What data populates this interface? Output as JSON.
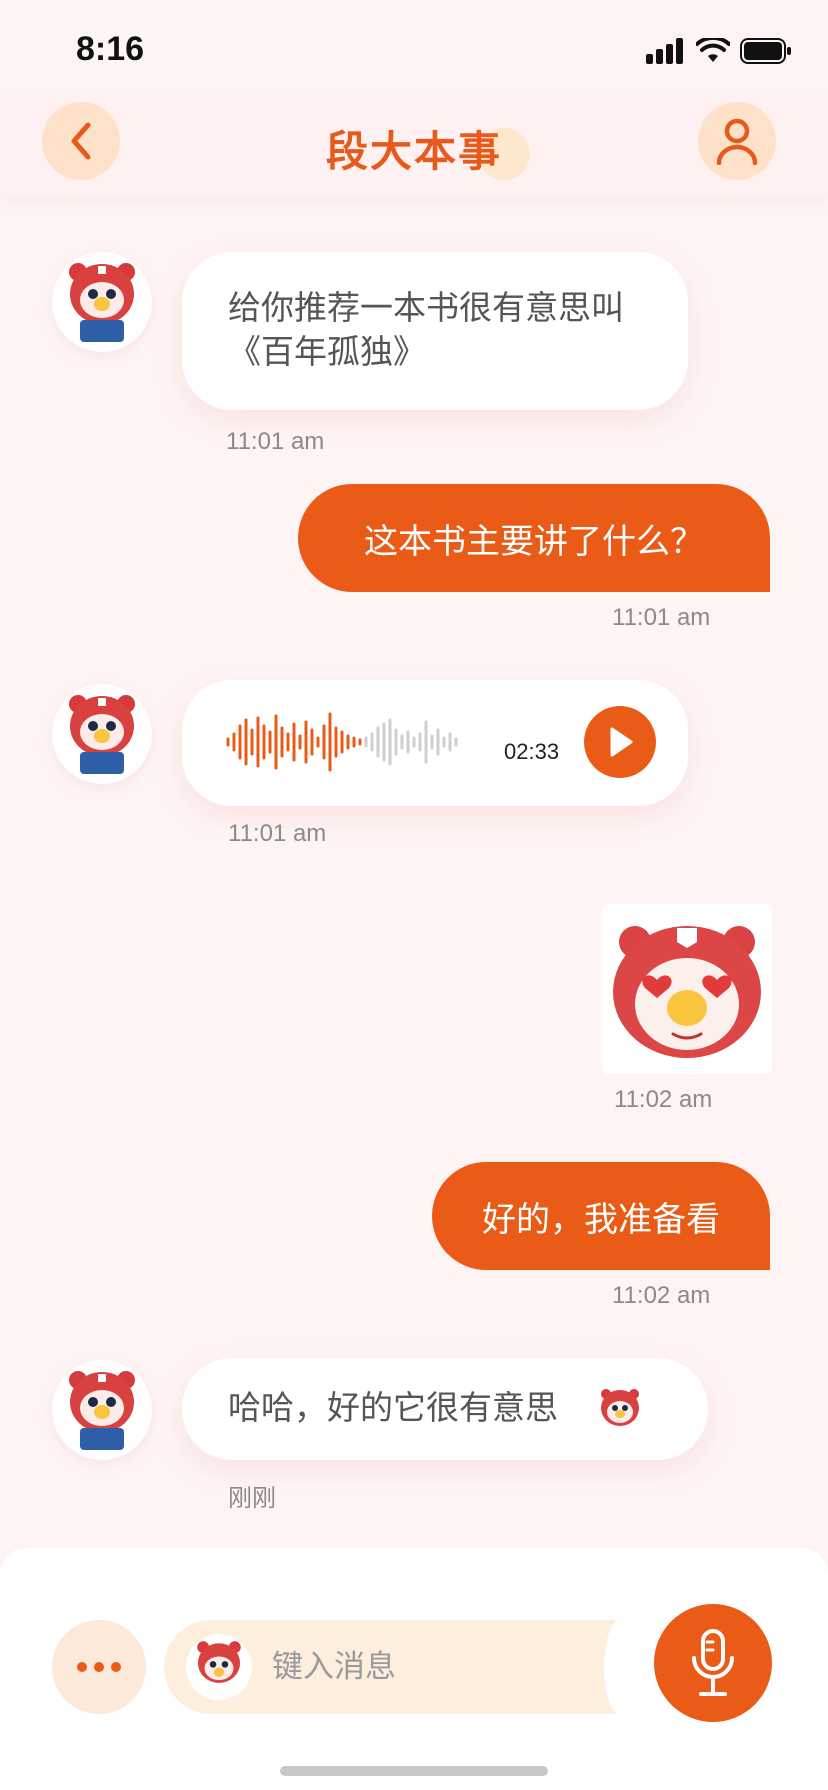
{
  "status_bar": {
    "time": "8:16"
  },
  "header": {
    "title": "段大本事"
  },
  "messages": [
    {
      "side": "in",
      "text": "给你推荐一本书很有意思叫《百年孤独》",
      "time": "11:01 am"
    },
    {
      "side": "out",
      "text": "这本书主要讲了什么？",
      "time": "11:01 am"
    },
    {
      "side": "in",
      "type": "voice",
      "duration": "02:33",
      "time": "11:01 am"
    },
    {
      "side": "out",
      "type": "sticker",
      "sticker": "bear-heart-eyes-sticker",
      "time": "11:02 am"
    },
    {
      "side": "out",
      "text": "好的，我准备看",
      "time": "11:02 am"
    },
    {
      "side": "in",
      "text": "哈哈，好的它很有意思",
      "time": "刚刚"
    }
  ],
  "composer": {
    "placeholder": "键入消息"
  },
  "colors": {
    "accent": "#ea5b17",
    "accent_soft": "#fde1c9",
    "background": "#fff4f4",
    "bubble_in": "#ffffff"
  }
}
